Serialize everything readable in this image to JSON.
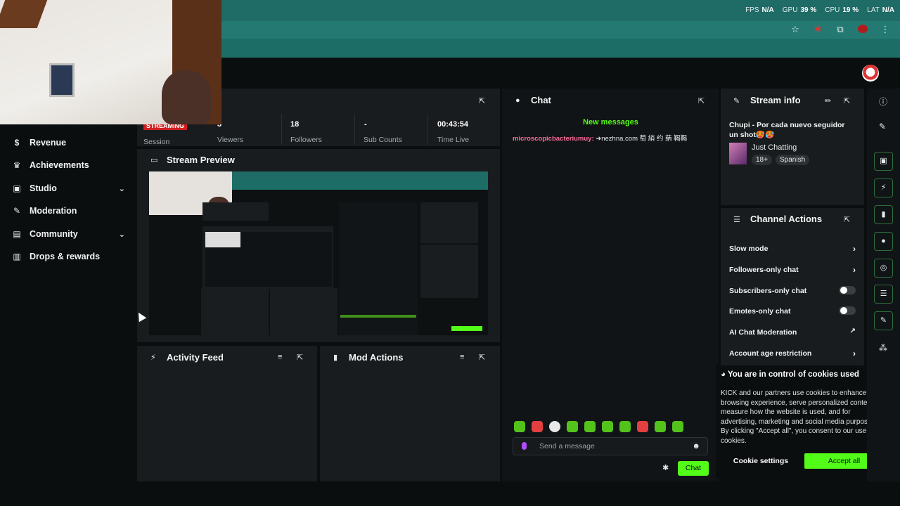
{
  "browser": {
    "perf": {
      "fps_label": "FPS",
      "fps": "N/A",
      "gpu_label": "GPU",
      "gpu": "39 %",
      "cpu_label": "CPU",
      "cpu": "19 %",
      "lat_label": "LAT",
      "lat": "N/A"
    },
    "icons": [
      "star-icon",
      "extension-red-icon",
      "puzzle-icon",
      "profile-icon",
      "menu-dots-icon"
    ]
  },
  "sidebar": {
    "items": [
      {
        "label": "Revenue",
        "icon": "dollar-icon"
      },
      {
        "label": "Achievements",
        "icon": "trophy-icon"
      },
      {
        "label": "Studio",
        "icon": "studio-icon",
        "expandable": true
      },
      {
        "label": "Moderation",
        "icon": "wrench-icon"
      },
      {
        "label": "Community",
        "icon": "community-icon",
        "expandable": true
      },
      {
        "label": "Drops & rewards",
        "icon": "drops-icon"
      }
    ]
  },
  "stats": {
    "badge": "STREAMING",
    "session_label": "Session",
    "viewers_value": "3",
    "viewers_label": "Viewers",
    "followers_value": "18",
    "followers_label": "Followers",
    "subs_value": "-",
    "subs_label": "Sub Counts",
    "time_value": "00:43:54",
    "time_label": "Time Live"
  },
  "preview": {
    "title": "Stream Preview"
  },
  "activity": {
    "title": "Activity Feed"
  },
  "mod_actions": {
    "title": "Mod Actions"
  },
  "chat": {
    "title": "Chat",
    "new_messages": "New messages",
    "message": {
      "user": "microscopicbacteriumuy:",
      "text": " ➔nezhna.com 萄 綃 约 蒳 鞨鞨"
    },
    "input_placeholder": "Send a message",
    "send_label": "Chat"
  },
  "stream_info": {
    "title": "Stream info",
    "stream_title": "Chupi - Por cada nuevo seguidor un shot🥵🥵",
    "category": "Just Chatting",
    "tags": [
      "18+",
      "Spanish"
    ]
  },
  "channel_actions": {
    "title": "Channel Actions",
    "rows": [
      {
        "label": "Slow mode",
        "control": "chevron"
      },
      {
        "label": "Followers-only chat",
        "control": "chevron"
      },
      {
        "label": "Subscribers-only chat",
        "control": "toggle"
      },
      {
        "label": "Emotes-only chat",
        "control": "toggle"
      },
      {
        "label": "AI Chat Moderation",
        "control": "external"
      },
      {
        "label": "Account age restriction",
        "control": "chevron"
      }
    ]
  },
  "cookies": {
    "title": "You are in control of cookies used",
    "text": "KICK and our partners use cookies to enhance your browsing experience, serve personalized content, measure how the website is used, and for advertising, marketing and social media purposes. By clicking \"Accept all\", you consent to our use of cookies.",
    "settings_label": "Cookie settings",
    "accept_label": "Accept all"
  },
  "colors": {
    "brand_green": "#53fc18",
    "live_red": "#d11f1f",
    "panel_bg": "#191c1e",
    "app_bg": "#0b0e0f",
    "chrome_teal": "#1f6b66"
  }
}
